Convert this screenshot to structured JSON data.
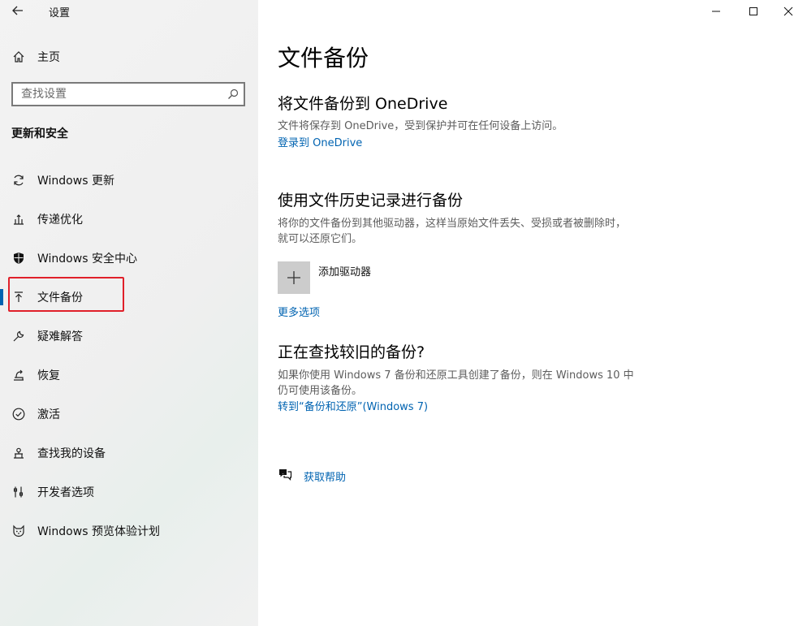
{
  "window": {
    "title": "设置"
  },
  "sidebar": {
    "home_label": "主页",
    "search_placeholder": "查找设置",
    "section_title": "更新和安全",
    "items": [
      {
        "label": "Windows 更新",
        "icon": "sync-icon"
      },
      {
        "label": "传递优化",
        "icon": "delivery-optimization-icon"
      },
      {
        "label": "Windows 安全中心",
        "icon": "shield-icon"
      },
      {
        "label": "文件备份",
        "icon": "backup-arrow-icon",
        "selected": true
      },
      {
        "label": "疑难解答",
        "icon": "wrench-icon"
      },
      {
        "label": "恢复",
        "icon": "recovery-icon"
      },
      {
        "label": "激活",
        "icon": "check-circle-icon"
      },
      {
        "label": "查找我的设备",
        "icon": "find-device-icon"
      },
      {
        "label": "开发者选项",
        "icon": "developer-icon"
      },
      {
        "label": "Windows 预览体验计划",
        "icon": "insider-cat-icon"
      }
    ]
  },
  "main": {
    "title": "文件备份",
    "onedrive": {
      "heading": "将文件备份到 OneDrive",
      "description": "文件将保存到 OneDrive，受到保护并可在任何设备上访问。",
      "link": "登录到 OneDrive"
    },
    "file_history": {
      "heading": "使用文件历史记录进行备份",
      "description": "将你的文件备份到其他驱动器，这样当原始文件丢失、受损或者被删除时，就可以还原它们。",
      "add_drive_label": "添加驱动器",
      "more_options_link": "更多选项"
    },
    "older_backup": {
      "heading": "正在查找较旧的备份?",
      "description": "如果你使用 Windows 7 备份和还原工具创建了备份，则在 Windows 10 中仍可使用该备份。",
      "link": "转到“备份和还原”(Windows 7)"
    },
    "help_link": "获取帮助"
  },
  "colors": {
    "accent": "#0063b1",
    "highlight_box": "#e0202a",
    "add_button_bg": "#cccccc"
  }
}
